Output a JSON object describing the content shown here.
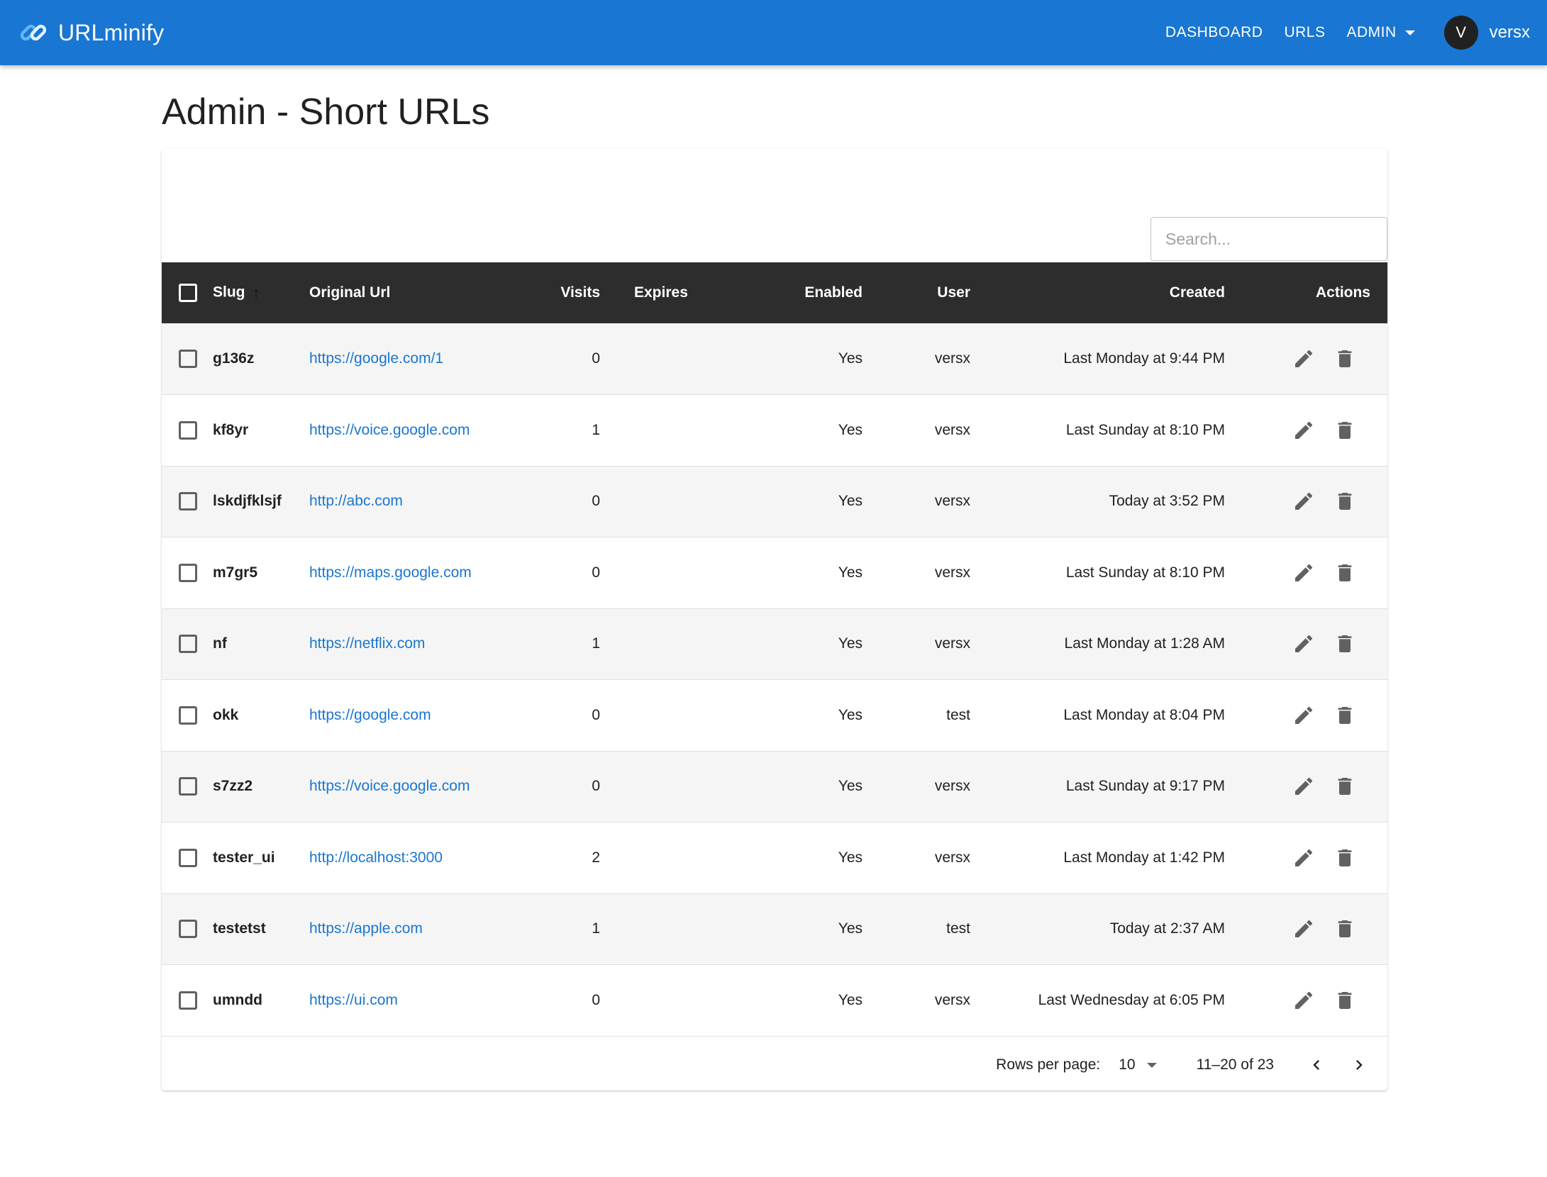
{
  "app": {
    "name": "URLminify",
    "accent": "#1976d2"
  },
  "nav": {
    "dashboard": "DASHBOARD",
    "urls": "URLS",
    "admin": "ADMIN",
    "user_initial": "V",
    "user_name": "versx"
  },
  "page": {
    "title": "Admin - Short URLs"
  },
  "search": {
    "placeholder": "Search..."
  },
  "table": {
    "columns": {
      "slug": "Slug",
      "original_url": "Original Url",
      "visits": "Visits",
      "expires": "Expires",
      "enabled": "Enabled",
      "user": "User",
      "created": "Created",
      "actions": "Actions"
    },
    "rows": [
      {
        "slug": "g136z",
        "url": "https://google.com/1",
        "visits": "0",
        "expires": "",
        "enabled": "Yes",
        "user": "versx",
        "created": "Last Monday at 9:44 PM"
      },
      {
        "slug": "kf8yr",
        "url": "https://voice.google.com",
        "visits": "1",
        "expires": "",
        "enabled": "Yes",
        "user": "versx",
        "created": "Last Sunday at 8:10 PM"
      },
      {
        "slug": "lskdjfklsjf",
        "url": "http://abc.com",
        "visits": "0",
        "expires": "",
        "enabled": "Yes",
        "user": "versx",
        "created": "Today at 3:52 PM"
      },
      {
        "slug": "m7gr5",
        "url": "https://maps.google.com",
        "visits": "0",
        "expires": "",
        "enabled": "Yes",
        "user": "versx",
        "created": "Last Sunday at 8:10 PM"
      },
      {
        "slug": "nf",
        "url": "https://netflix.com",
        "visits": "1",
        "expires": "",
        "enabled": "Yes",
        "user": "versx",
        "created": "Last Monday at 1:28 AM"
      },
      {
        "slug": "okk",
        "url": "https://google.com",
        "visits": "0",
        "expires": "",
        "enabled": "Yes",
        "user": "test",
        "created": "Last Monday at 8:04 PM"
      },
      {
        "slug": "s7zz2",
        "url": "https://voice.google.com",
        "visits": "0",
        "expires": "",
        "enabled": "Yes",
        "user": "versx",
        "created": "Last Sunday at 9:17 PM"
      },
      {
        "slug": "tester_ui",
        "url": "http://localhost:3000",
        "visits": "2",
        "expires": "",
        "enabled": "Yes",
        "user": "versx",
        "created": "Last Monday at 1:42 PM"
      },
      {
        "slug": "testetst",
        "url": "https://apple.com",
        "visits": "1",
        "expires": "",
        "enabled": "Yes",
        "user": "test",
        "created": "Today at 2:37 AM"
      },
      {
        "slug": "umndd",
        "url": "https://ui.com",
        "visits": "0",
        "expires": "",
        "enabled": "Yes",
        "user": "versx",
        "created": "Last Wednesday at 6:05 PM"
      }
    ],
    "icons": {
      "edit": "pencil-icon",
      "delete": "trash-icon",
      "sort": "arrow-up-icon"
    }
  },
  "pagination": {
    "rows_per_page_label": "Rows per page:",
    "rows_per_page": "10",
    "range": "11–20 of 23"
  }
}
